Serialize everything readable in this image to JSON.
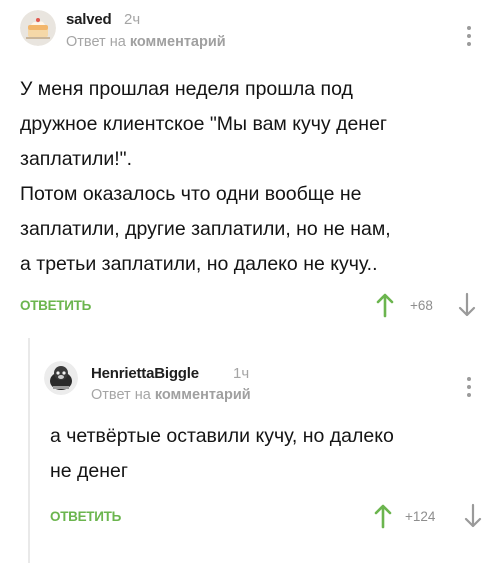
{
  "comments": [
    {
      "username": "salved",
      "time": "2ч",
      "reply_prefix": "Ответ на",
      "reply_target": "комментарий",
      "text_lines": [
        "У меня прошлая неделя прошла под",
        "дружное клиентское \"Мы вам кучу денег",
        "заплатили!\".",
        "Потом оказалось что одни вообще не",
        "заплатили, другие заплатили, но не нам,",
        "а третьи заплатили, но далеко не кучу.."
      ],
      "reply_label": "ОТВЕТИТЬ",
      "rating": "+68",
      "avatar_icon": "cake-avatar-icon"
    },
    {
      "username": "HenriettaBiggle",
      "time": "1ч",
      "reply_prefix": "Ответ на",
      "reply_target": "комментарий",
      "text_lines": [
        "а четвёртые оставили кучу, но далеко",
        "не денег"
      ],
      "reply_label": "ОТВЕТИТЬ",
      "rating": "+124",
      "avatar_icon": "animal-avatar-icon"
    }
  ],
  "colors": {
    "accent_green": "#6bb54e",
    "muted_text": "#a5a5a5",
    "main_text": "#141414"
  }
}
